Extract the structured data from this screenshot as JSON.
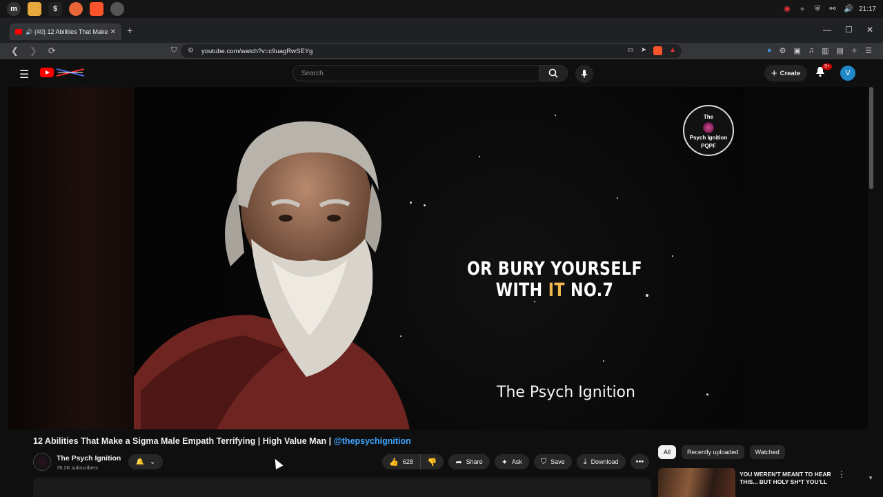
{
  "system": {
    "clock": "21:17"
  },
  "browser": {
    "tab_title": "(40) 12 Abilities That Make",
    "url": "youtube.com/watch?v=c9uagRwSEYg",
    "new_tab_symbol": "+"
  },
  "youtube": {
    "search_placeholder": "Search",
    "create_label": "Create",
    "notification_count": "9+",
    "avatar_letter": "V"
  },
  "video": {
    "caption_part1": "OR BURY YOURSELF WITH ",
    "caption_highlight": "IT",
    "caption_part2": " NO.7",
    "watermark_text": "The Psych Ignition",
    "badge_line1": "The",
    "badge_line2": "Psych Ignition",
    "badge_line3": "PQPF",
    "accent_color": "#f0b84a"
  },
  "watch": {
    "title": "12 Abilities That Make a Sigma Male Empath Terrifying | High Value Man | ",
    "title_tag": "@thepsychignition",
    "channel_name": "The Psych Ignition",
    "subscribers": "78.2K subscribers",
    "like_count": "628",
    "share_label": "Share",
    "ask_label": "Ask",
    "save_label": "Save",
    "download_label": "Download"
  },
  "sidebar": {
    "chips": [
      "All",
      "Recently uploaded",
      "Watched"
    ],
    "rec_title": "YOU WEREN'T MEANT TO HEAR THIS... BUT HOLY SH*T YOU'LL"
  }
}
